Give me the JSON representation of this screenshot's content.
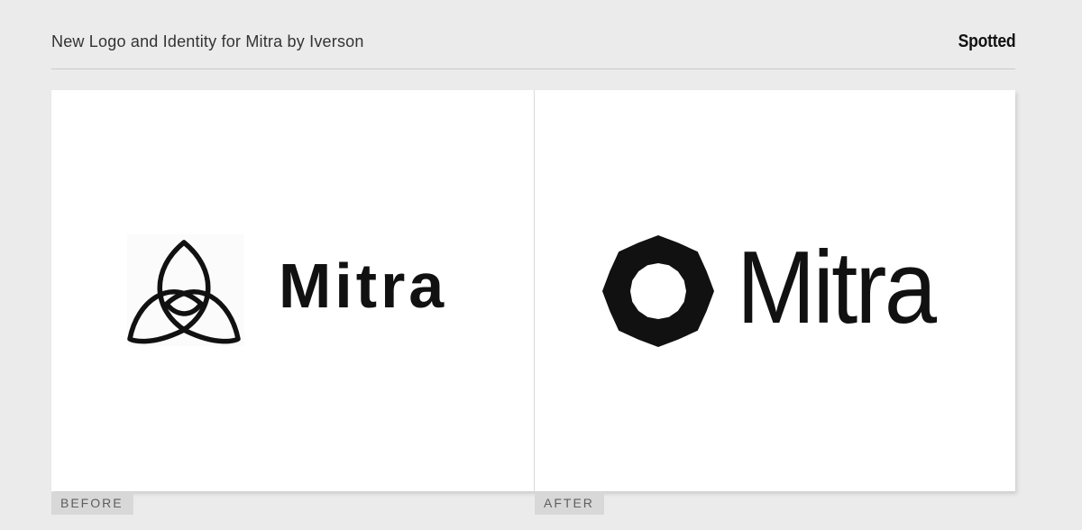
{
  "header": {
    "title": "New Logo and Identity for Mitra by Iverson",
    "brand": "Spotted"
  },
  "comparison": {
    "before": {
      "wordmark": "Mitra",
      "label": "BEFORE",
      "icon": "triquetra-icon"
    },
    "after": {
      "wordmark": "Mitra",
      "label": "AFTER",
      "icon": "eight-point-star-icon"
    }
  },
  "colors": {
    "background": "#ebebeb",
    "panel": "#ffffff",
    "ink": "#111111",
    "tag_background": "#d8d8d8",
    "tag_text": "#5e5e5e"
  }
}
